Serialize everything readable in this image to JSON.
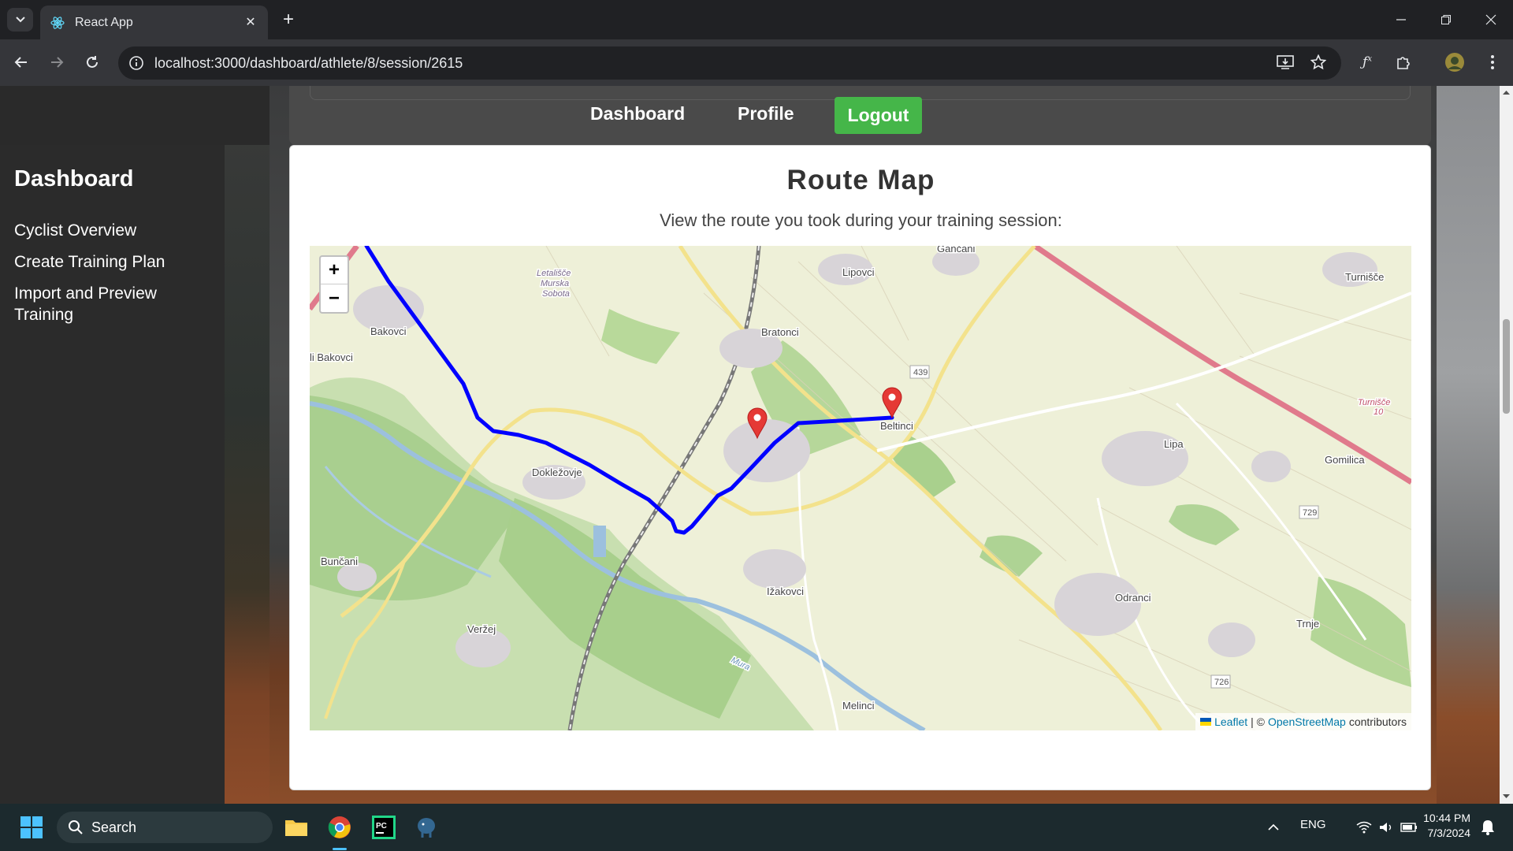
{
  "browser": {
    "tab_title": "React App",
    "url": "localhost:3000/dashboard/athlete/8/session/2615"
  },
  "header": {
    "nav_dashboard": "Dashboard",
    "nav_profile": "Profile",
    "logout_label": "Logout",
    "logout_color": "#45b649"
  },
  "sidebar": {
    "title": "Dashboard",
    "items": [
      {
        "label": "Cyclist Overview"
      },
      {
        "label": "Create Training Plan"
      },
      {
        "label": "Import and Preview Training"
      }
    ]
  },
  "main": {
    "title": "Route Map",
    "subtitle": "View the route you took during your training session:"
  },
  "map": {
    "zoom_in": "+",
    "zoom_out": "−",
    "route_color": "#0000ff",
    "marker_color": "#e53935",
    "place_labels": {
      "gancani": "Gančani",
      "lipovci": "Lipovci",
      "turnisce": "Turnišče",
      "letalisce": "Letališče",
      "murska": "Murska",
      "sobota": "Sobota",
      "bakovci": "Bakovci",
      "bakovci2": "li Bakovci",
      "bratonci": "Bratonci",
      "r439": "439",
      "beltinci": "Beltinci",
      "lipa": "Lipa",
      "gomilica": "Gomilica",
      "dokezovje": "Dokležovje",
      "r729": "729",
      "buncani": "Bunčani",
      "ižakovci": "Ižakovci",
      "odranci": "Odranci",
      "trnje": "Trnje",
      "verzej": "Veržej",
      "r726": "726",
      "melinci": "Melinci",
      "turnisce10": "Turnišče",
      "turnisce10b": "10",
      "mura": "Mura"
    },
    "attribution": {
      "leaflet": "Leaflet",
      "separator": "| ©",
      "osm": "OpenStreetMap",
      "contributors": "contributors"
    }
  },
  "taskbar": {
    "search_placeholder": "Search",
    "lang": "ENG",
    "time": "10:44 PM",
    "date": "7/3/2024"
  }
}
